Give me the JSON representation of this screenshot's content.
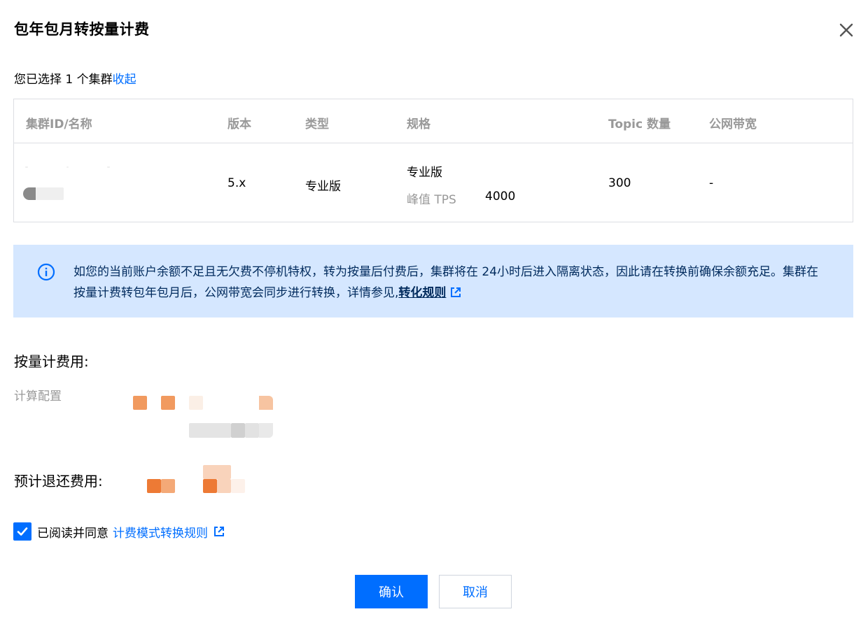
{
  "dialog": {
    "title": "包年包月转按量计费"
  },
  "selection": {
    "text": "您已选择 1 个集群",
    "collapse_label": "收起"
  },
  "table": {
    "headers": {
      "cluster": "集群ID/名称",
      "version": "版本",
      "type": "类型",
      "spec": "规格",
      "topics": "Topic 数量",
      "bandwidth": "公网带宽"
    },
    "row": {
      "version": "5.x",
      "type": "专业版",
      "spec_name": "专业版",
      "spec_tps_label": "峰值 TPS",
      "spec_tps_value": "4000",
      "topics": "300",
      "bandwidth": "-"
    }
  },
  "notice": {
    "text": "如您的当前账户余额不足且无欠费不停机特权，转为按量后付费后，集群将在 24小时后进入隔离状态，因此请在转换前确保余额充足。集群在按量计费转包年包月后，公网带宽会同步进行转换，详情参见,",
    "link_label": "转化规则"
  },
  "costs": {
    "payg_label": "按量计费用:",
    "compute_label": "计算配置",
    "refund_label": "预计退还费用:"
  },
  "agreement": {
    "text": "已阅读并同意",
    "link_label": "计费模式转换规则",
    "checked": true
  },
  "actions": {
    "confirm_label": "确认",
    "cancel_label": "取消"
  },
  "colors": {
    "accent": "#006eff",
    "notice_bg": "#d5e7ff",
    "muted_text": "#999999",
    "border": "#dcdee3"
  }
}
